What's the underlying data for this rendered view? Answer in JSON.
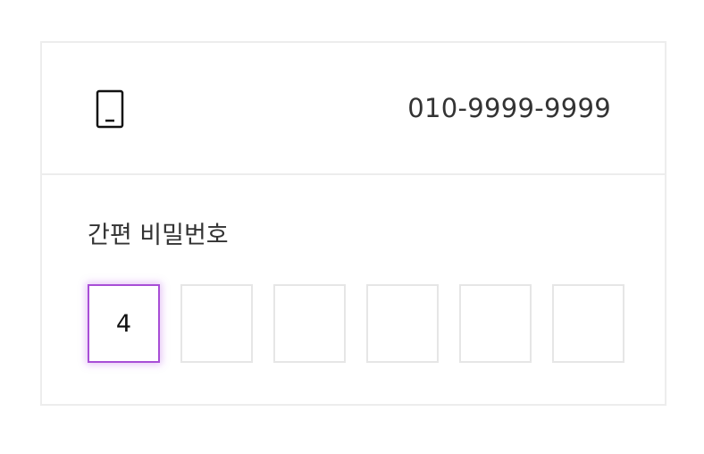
{
  "phone": {
    "icon": "smartphone-icon",
    "number": "010-9999-9999"
  },
  "pin": {
    "label": "간편 비밀번호",
    "digits": [
      "4",
      "",
      "",
      "",
      "",
      ""
    ],
    "active_index": 0,
    "accent_color": "#a84ed6"
  }
}
